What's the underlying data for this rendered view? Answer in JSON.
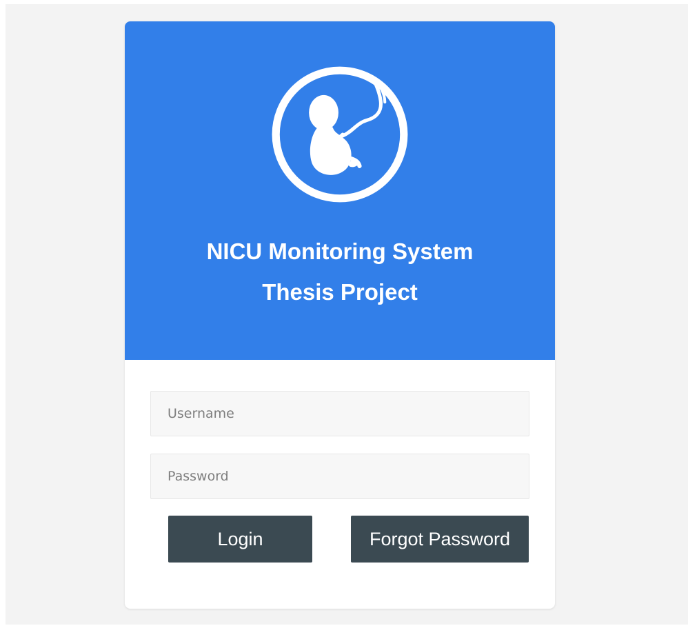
{
  "header": {
    "logo_icon": "fetus-icon",
    "title_line1": "NICU Monitoring System",
    "title_line2": "Thesis Project",
    "background_color": "#327fe9"
  },
  "form": {
    "username_placeholder": "Username",
    "username_value": "",
    "password_placeholder": "Password",
    "password_value": ""
  },
  "buttons": {
    "login_label": "Login",
    "forgot_label": "Forgot Password",
    "button_color": "#3b4a52"
  }
}
